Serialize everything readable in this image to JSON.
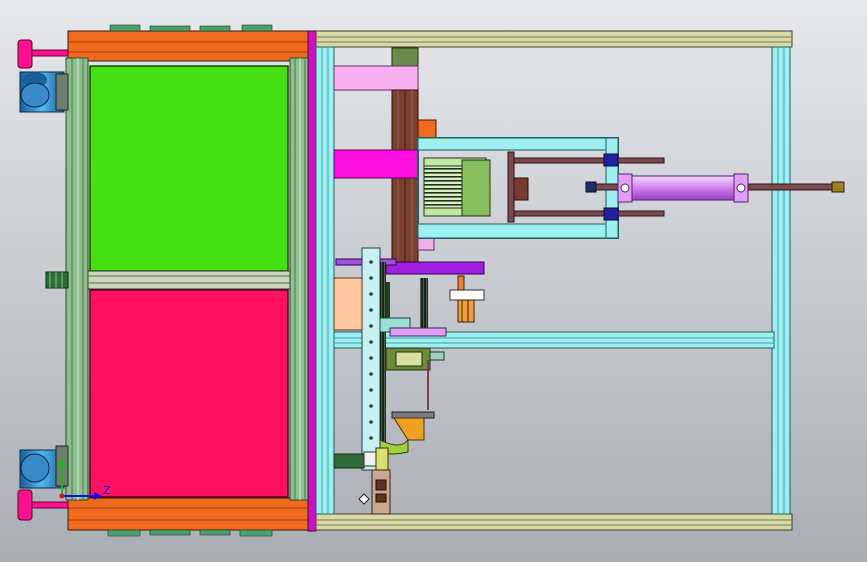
{
  "viewport": {
    "background_top": "#e6e8ec",
    "background_bottom": "#a9adb4"
  },
  "triad": {
    "axis_label_z": "Z",
    "color_x": "#1010e0",
    "color_y": "#10c010",
    "color_z": "#e01010"
  },
  "palette": {
    "frame_orange": "#f06a1e",
    "frame_green": "#8fbf8f",
    "panel_green": "#44e012",
    "panel_red": "#ff1060",
    "magenta": "#d010c0",
    "pink": "#f8b0f0",
    "hot_magenta": "#ff10e0",
    "brown": "#7a4030",
    "cylinder_purple": "#d080f0",
    "rail_cyan": "#9ef0f0",
    "khaki": "#d8d8a8",
    "peach": "#ffc8a0",
    "navy": "#2020a0",
    "gold": "#f0a020",
    "caster_blue": "#40a8e0",
    "dark_green": "#305030"
  }
}
